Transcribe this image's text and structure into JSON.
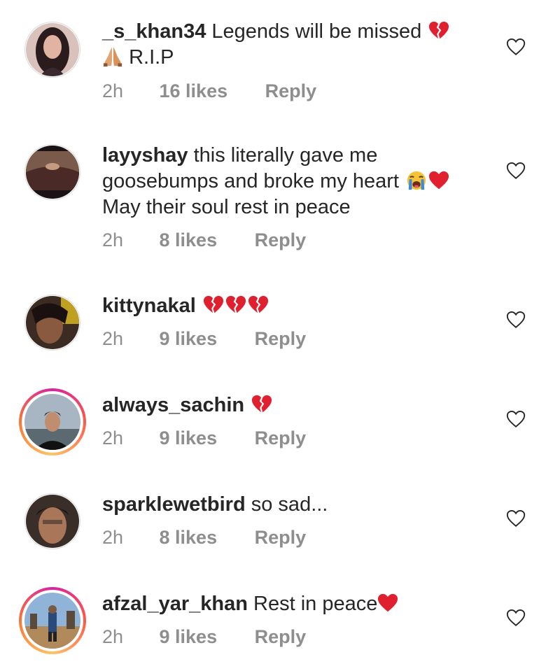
{
  "comments": [
    {
      "username": "_s_khan34",
      "text": "Legends will be missed",
      "text_after": "R.I.P",
      "emojis": [
        "broken-heart",
        "folded-hands"
      ],
      "time": "2h",
      "likes": "16 likes",
      "reply": "Reply",
      "has_story_ring": false
    },
    {
      "username": "layyshay",
      "text": "this literally gave me goosebumps and broke my heart",
      "text_after": "May their soul rest in peace",
      "emojis": [
        "crying-face",
        "red-heart"
      ],
      "time": "2h",
      "likes": "8 likes",
      "reply": "Reply",
      "has_story_ring": false
    },
    {
      "username": "kittynakal",
      "text": "",
      "emojis": [
        "broken-heart",
        "broken-heart",
        "broken-heart"
      ],
      "time": "2h",
      "likes": "9 likes",
      "reply": "Reply",
      "has_story_ring": false
    },
    {
      "username": "always_sachin",
      "text": "",
      "emojis": [
        "broken-heart"
      ],
      "time": "2h",
      "likes": "9 likes",
      "reply": "Reply",
      "has_story_ring": true
    },
    {
      "username": "sparklewetbird",
      "text": "so sad...",
      "emojis": [],
      "time": "2h",
      "likes": "8 likes",
      "reply": "Reply",
      "has_story_ring": false
    },
    {
      "username": "afzal_yar_khan",
      "text": "Rest in peace",
      "emojis": [
        "red-heart"
      ],
      "time": "2h",
      "likes": "9 likes",
      "reply": "Reply",
      "has_story_ring": true
    }
  ],
  "colors": {
    "text": "#262626",
    "meta": "#8e8e8e",
    "heart_red": "#e0202e",
    "ring_gradient": [
      "#d6249f",
      "#fd5949",
      "#fdc468"
    ]
  }
}
